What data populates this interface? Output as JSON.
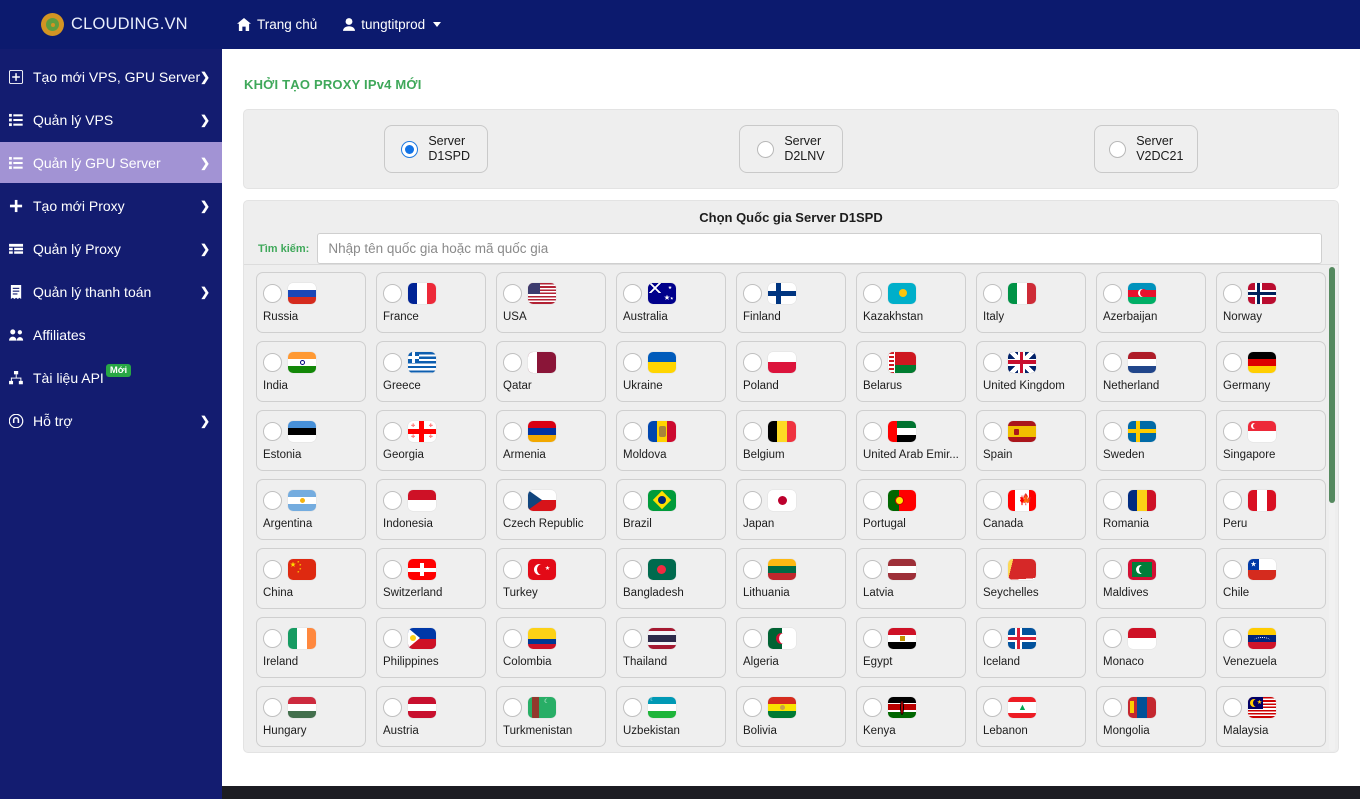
{
  "brand": {
    "name": "CLOUDING.VN",
    "logo_icon": "target-circle-logo"
  },
  "navbar": {
    "home_label": "Trang chủ",
    "home_icon": "home-icon",
    "user_label": "tungtitprod",
    "user_icon": "user-icon",
    "caret_icon": "chevron-down-icon"
  },
  "sidebar": {
    "items": [
      {
        "label": "Tạo mới VPS, GPU Server",
        "icon": "plus-square-icon",
        "arrow": "chevron-right-icon",
        "active": false,
        "badge": ""
      },
      {
        "label": "Quản lý VPS",
        "icon": "list-icon",
        "arrow": "chevron-right-icon",
        "active": false,
        "badge": ""
      },
      {
        "label": "Quản lý GPU Server",
        "icon": "list-icon",
        "arrow": "chevron-right-icon",
        "active": true,
        "badge": ""
      },
      {
        "label": "Tạo mới Proxy",
        "icon": "plus-icon",
        "arrow": "chevron-right-icon",
        "active": false,
        "badge": ""
      },
      {
        "label": "Quản lý Proxy",
        "icon": "table-icon",
        "arrow": "chevron-right-icon",
        "active": false,
        "badge": ""
      },
      {
        "label": "Quản lý thanh toán",
        "icon": "receipt-icon",
        "arrow": "chevron-right-icon",
        "active": false,
        "badge": ""
      },
      {
        "label": "Affiliates",
        "icon": "users-icon",
        "arrow": "",
        "active": false,
        "badge": ""
      },
      {
        "label": "Tài liệu API",
        "icon": "sitemap-icon",
        "arrow": "",
        "active": false,
        "badge": "Mới"
      },
      {
        "label": "Hỗ trợ",
        "icon": "headset-icon",
        "arrow": "chevron-right-icon",
        "active": false,
        "badge": ""
      }
    ]
  },
  "main": {
    "page_title": "KHỞI TẠO PROXY IPv4 MỚI",
    "servers": [
      {
        "line1": "Server",
        "line2": "D1SPD",
        "selected": true
      },
      {
        "line1": "Server",
        "line2": "D2LNV",
        "selected": false
      },
      {
        "line1": "Server",
        "line2": "V2DC21",
        "selected": false
      }
    ],
    "country_section_title": "Chọn Quốc gia Server D1SPD",
    "search": {
      "label": "Tìm kiếm:",
      "placeholder": "Nhập tên quốc gia hoặc mã quốc gia",
      "value": ""
    },
    "countries": [
      {
        "name": "Russia",
        "flag": "ru"
      },
      {
        "name": "France",
        "flag": "fr"
      },
      {
        "name": "USA",
        "flag": "us"
      },
      {
        "name": "Australia",
        "flag": "au"
      },
      {
        "name": "Finland",
        "flag": "fi"
      },
      {
        "name": "Kazakhstan",
        "flag": "kz"
      },
      {
        "name": "Italy",
        "flag": "it"
      },
      {
        "name": "Azerbaijan",
        "flag": "az"
      },
      {
        "name": "Norway",
        "flag": "no"
      },
      {
        "name": "India",
        "flag": "in"
      },
      {
        "name": "Greece",
        "flag": "gr"
      },
      {
        "name": "Qatar",
        "flag": "qa"
      },
      {
        "name": "Ukraine",
        "flag": "ua"
      },
      {
        "name": "Poland",
        "flag": "pl"
      },
      {
        "name": "Belarus",
        "flag": "by"
      },
      {
        "name": "United Kingdom",
        "flag": "gb"
      },
      {
        "name": "Netherland",
        "flag": "nl"
      },
      {
        "name": "Germany",
        "flag": "de"
      },
      {
        "name": "Estonia",
        "flag": "ee"
      },
      {
        "name": "Georgia",
        "flag": "ge"
      },
      {
        "name": "Armenia",
        "flag": "am"
      },
      {
        "name": "Moldova",
        "flag": "md"
      },
      {
        "name": "Belgium",
        "flag": "be"
      },
      {
        "name": "United Arab Emir...",
        "flag": "ae"
      },
      {
        "name": "Spain",
        "flag": "es"
      },
      {
        "name": "Sweden",
        "flag": "se"
      },
      {
        "name": "Singapore",
        "flag": "sg"
      },
      {
        "name": "Argentina",
        "flag": "ar"
      },
      {
        "name": "Indonesia",
        "flag": "id"
      },
      {
        "name": "Czech Republic",
        "flag": "cz"
      },
      {
        "name": "Brazil",
        "flag": "br"
      },
      {
        "name": "Japan",
        "flag": "jp"
      },
      {
        "name": "Portugal",
        "flag": "pt"
      },
      {
        "name": "Canada",
        "flag": "ca"
      },
      {
        "name": "Romania",
        "flag": "ro"
      },
      {
        "name": "Peru",
        "flag": "pe"
      },
      {
        "name": "China",
        "flag": "cn"
      },
      {
        "name": "Switzerland",
        "flag": "ch"
      },
      {
        "name": "Turkey",
        "flag": "tr"
      },
      {
        "name": "Bangladesh",
        "flag": "bd"
      },
      {
        "name": "Lithuania",
        "flag": "lt"
      },
      {
        "name": "Latvia",
        "flag": "lv"
      },
      {
        "name": "Seychelles",
        "flag": "sc"
      },
      {
        "name": "Maldives",
        "flag": "mv"
      },
      {
        "name": "Chile",
        "flag": "cl"
      },
      {
        "name": "Ireland",
        "flag": "ie"
      },
      {
        "name": "Philippines",
        "flag": "ph"
      },
      {
        "name": "Colombia",
        "flag": "co"
      },
      {
        "name": "Thailand",
        "flag": "th"
      },
      {
        "name": "Algeria",
        "flag": "dz"
      },
      {
        "name": "Egypt",
        "flag": "eg"
      },
      {
        "name": "Iceland",
        "flag": "is"
      },
      {
        "name": "Monaco",
        "flag": "mc"
      },
      {
        "name": "Venezuela",
        "flag": "ve"
      },
      {
        "name": "Hungary",
        "flag": "hu"
      },
      {
        "name": "Austria",
        "flag": "at"
      },
      {
        "name": "Turkmenistan",
        "flag": "tm"
      },
      {
        "name": "Uzbekistan",
        "flag": "uz"
      },
      {
        "name": "Bolivia",
        "flag": "bo"
      },
      {
        "name": "Kenya",
        "flag": "ke"
      },
      {
        "name": "Lebanon",
        "flag": "lb"
      },
      {
        "name": "Mongolia",
        "flag": "mn"
      },
      {
        "name": "Malaysia",
        "flag": "my"
      }
    ]
  },
  "colors": {
    "navbar_bg": "#0c1a6e",
    "sidebar_bg": "#131c70",
    "sidebar_active_bg": "#a293d4",
    "accent_green": "#3fa85a",
    "badge_green": "#28a745",
    "radio_blue": "#1273e6",
    "scrollbar_green": "#55895f"
  }
}
